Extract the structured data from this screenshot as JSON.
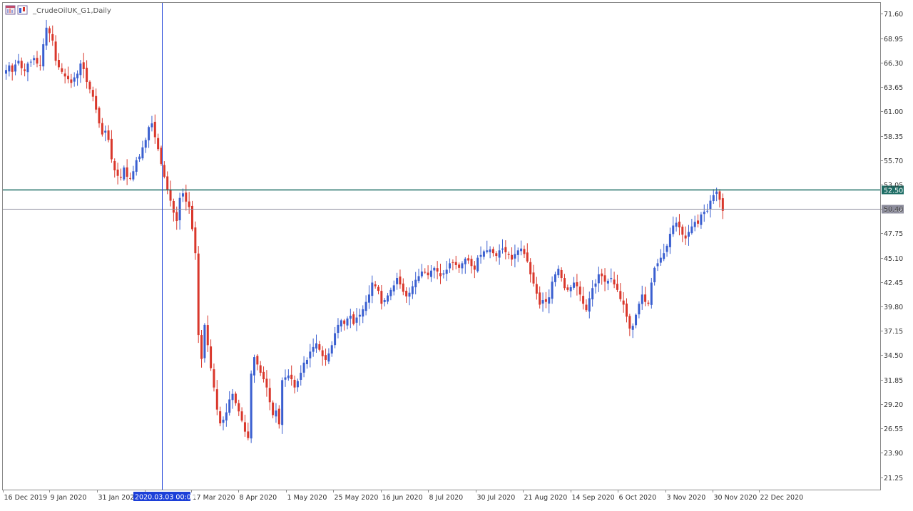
{
  "window": {
    "title": "_CrudeOilUK_G1,Daily"
  },
  "colors": {
    "background": "#ffffff",
    "frame": "#8a8a8a",
    "bull": "#3a5fd0",
    "bear": "#d9372b",
    "crosshair": "#1c3fd8",
    "resistance_line": "#1e6e66",
    "bid_line": "#8c8c9c",
    "resistance_label_bg": "#1e6e66",
    "bid_label_bg": "#8c8c9c",
    "time_label_bg": "#1c3fd8"
  },
  "icons": [
    "chart-window-icon",
    "chart-type-icon"
  ],
  "chart_data": {
    "type": "candlestick",
    "title": "_CrudeOilUK_G1,Daily",
    "ylim": [
      19.9,
      72.8
    ],
    "y_ticks": [
      "71.60",
      "68.95",
      "66.30",
      "63.65",
      "61.00",
      "58.35",
      "55.70",
      "53.05",
      "50.40",
      "47.75",
      "45.10",
      "42.45",
      "39.80",
      "37.15",
      "34.50",
      "31.85",
      "29.20",
      "26.55",
      "23.90",
      "21.25"
    ],
    "x_ticks": [
      "16 Dec 2019",
      "9 Jan 2020",
      "31 Jan 2020",
      "",
      "17 Mar 2020",
      "8 Apr 2020",
      "1 May 2020",
      "25 May 2020",
      "16 Jun 2020",
      "8 Jul 2020",
      "30 Jul 2020",
      "21 Aug 2020",
      "14 Sep 2020",
      "6 Oct 2020",
      "3 Nov 2020",
      "30 Nov 2020",
      "22 Dec 2020"
    ],
    "crosshair_time_label": "2020.03.03 00:00",
    "horizontal_lines": [
      {
        "name": "resistance",
        "value": 52.5,
        "label": "52.50"
      },
      {
        "name": "bid",
        "value": 50.42,
        "label": "50.42"
      }
    ],
    "closes": [
      65.5,
      66.0,
      65.3,
      66.1,
      66.5,
      65.7,
      65.4,
      66.2,
      66.4,
      66.8,
      66.2,
      66.0,
      68.3,
      70.1,
      69.5,
      68.7,
      66.5,
      65.8,
      65.3,
      64.8,
      64.5,
      64.1,
      64.7,
      65.1,
      66.2,
      65.6,
      64.2,
      63.4,
      62.6,
      61.2,
      59.7,
      58.5,
      58.9,
      57.9,
      55.8,
      54.6,
      54.0,
      53.8,
      54.9,
      53.9,
      53.7,
      54.5,
      55.7,
      56.1,
      57.1,
      57.9,
      59.3,
      59.7,
      58.2,
      56.9,
      55.3,
      53.9,
      52.5,
      51.3,
      50.0,
      49.1,
      51.6,
      52.1,
      51.2,
      50.6,
      48.2,
      45.6,
      36.7,
      34.1,
      37.8,
      35.6,
      33.1,
      31.0,
      28.6,
      27.1,
      27.5,
      28.3,
      29.7,
      30.3,
      29.3,
      28.4,
      27.4,
      26.2,
      25.5,
      32.5,
      34.3,
      33.5,
      32.6,
      31.9,
      31.0,
      29.4,
      28.0,
      28.5,
      27.0,
      31.8,
      32.1,
      32.3,
      31.9,
      31.0,
      31.7,
      32.6,
      33.7,
      34.0,
      34.9,
      35.4,
      35.8,
      35.1,
      34.4,
      34.0,
      34.7,
      35.6,
      36.9,
      37.8,
      38.3,
      37.9,
      38.5,
      38.8,
      37.9,
      38.6,
      38.9,
      39.5,
      40.3,
      41.1,
      42.4,
      42.0,
      41.5,
      40.1,
      40.5,
      41.0,
      41.6,
      42.1,
      42.9,
      42.2,
      41.4,
      40.9,
      41.3,
      42.0,
      42.7,
      43.1,
      43.6,
      43.5,
      43.2,
      43.7,
      44.0,
      43.6,
      43.1,
      43.4,
      43.8,
      44.5,
      44.6,
      44.3,
      44.0,
      44.5,
      45.0,
      44.8,
      44.2,
      43.8,
      45.1,
      45.4,
      45.8,
      45.9,
      46.0,
      45.6,
      45.3,
      45.9,
      46.1,
      45.7,
      45.4,
      44.9,
      45.5,
      45.9,
      46.1,
      45.5,
      44.7,
      43.3,
      42.3,
      41.2,
      40.0,
      40.5,
      40.3,
      40.8,
      42.5,
      43.3,
      43.9,
      42.9,
      41.8,
      41.6,
      41.9,
      42.4,
      42.0,
      41.1,
      40.1,
      39.4,
      40.7,
      41.8,
      42.3,
      43.3,
      43.1,
      42.5,
      42.6,
      42.9,
      42.2,
      41.6,
      40.6,
      40.0,
      38.7,
      37.4,
      37.7,
      38.9,
      40.1,
      41.1,
      40.3,
      40.1,
      42.4,
      44.0,
      44.5,
      45.1,
      45.6,
      46.4,
      47.7,
      48.6,
      48.9,
      48.4,
      47.6,
      47.2,
      47.9,
      48.5,
      49.0,
      48.8,
      49.8,
      50.1,
      50.2,
      51.3,
      51.9,
      52.3,
      51.4,
      50.2
    ]
  }
}
